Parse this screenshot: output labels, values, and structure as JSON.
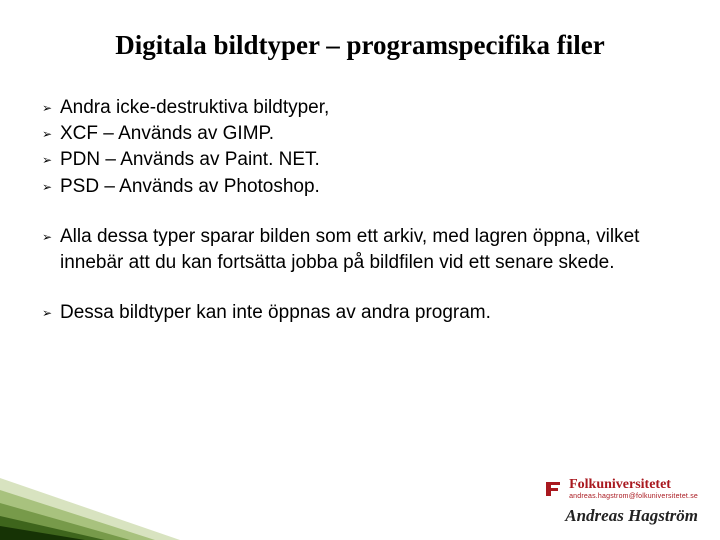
{
  "title": "Digitala bildtyper – programspecifika filer",
  "bullets": {
    "g1": [
      "Andra icke-destruktiva bildtyper,",
      "XCF – Används av GIMP.",
      "PDN – Används av Paint. NET.",
      "PSD – Används av Photoshop."
    ],
    "g2": [
      "Alla dessa typer sparar bilden som ett arkiv, med lagren öppna, vilket innebär att du kan fortsätta jobba på bildfilen vid ett senare skede."
    ],
    "g3": [
      "Dessa bildtyper kan inte öppnas av andra program."
    ]
  },
  "footer": {
    "org_name": "Folkuniversitetet",
    "org_sub": "andreas.hagstrom@folkuniversitetet.se",
    "author": "Andreas Hagström"
  }
}
